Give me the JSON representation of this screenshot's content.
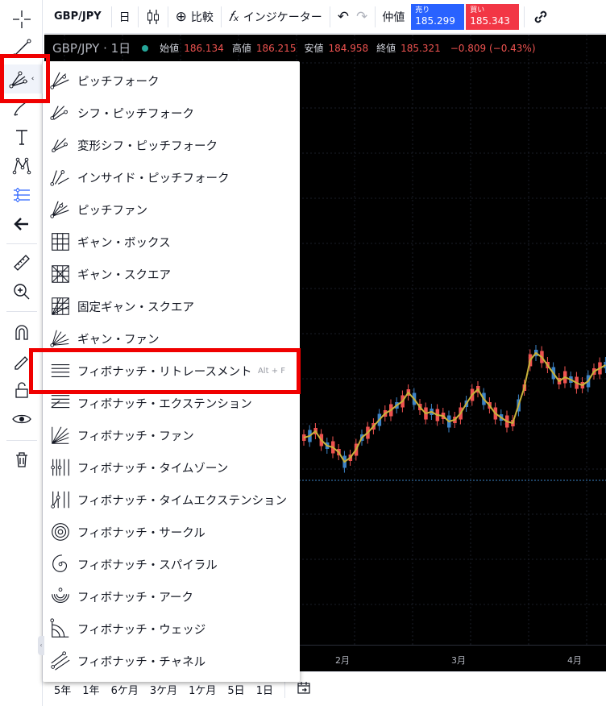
{
  "topbar": {
    "symbol": "GBP/JPY",
    "interval": "日",
    "compare_label": "比較",
    "indicators_label": "インジケーター",
    "mid_label": "仲値",
    "sell_label": "売り",
    "sell_price": "185.299",
    "buy_label": "買い",
    "buy_price": "185.343"
  },
  "legend": {
    "symbol": "GBP/JPY · 1日",
    "open_label": "始値",
    "open": "186.134",
    "high_label": "高値",
    "high": "186.215",
    "low_label": "安値",
    "low": "184.958",
    "close_label": "終値",
    "close": "185.321",
    "change": "−0.809 (−0.43%)"
  },
  "xaxis": {
    "labels": [
      "2月",
      "3月",
      "4月"
    ]
  },
  "bottombar": {
    "ranges": [
      "5年",
      "1年",
      "6ケ月",
      "3ケ月",
      "1ケ月",
      "5日",
      "1日"
    ]
  },
  "menu": {
    "items": [
      {
        "label": "ピッチフォーク",
        "icon": "pitchfork-icon"
      },
      {
        "label": "シフ・ピッチフォーク",
        "icon": "schiff-pitchfork-icon"
      },
      {
        "label": "変形シフ・ピッチフォーク",
        "icon": "modified-schiff-pitchfork-icon"
      },
      {
        "label": "インサイド・ピッチフォーク",
        "icon": "inside-pitchfork-icon"
      },
      {
        "label": "ピッチファン",
        "icon": "pitchfan-icon"
      },
      {
        "label": "ギャン・ボックス",
        "icon": "gann-box-icon"
      },
      {
        "label": "ギャン・スクエア",
        "icon": "gann-square-icon"
      },
      {
        "label": "固定ギャン・スクエア",
        "icon": "gann-square-fixed-icon"
      },
      {
        "label": "ギャン・ファン",
        "icon": "gann-fan-icon"
      },
      {
        "label": "フィボナッチ・リトレースメント",
        "icon": "fib-retracement-icon",
        "shortcut": "Alt + F"
      },
      {
        "label": "フィボナッチ・エクステンション",
        "icon": "fib-extension-icon"
      },
      {
        "label": "フィボナッチ・ファン",
        "icon": "fib-fan-icon"
      },
      {
        "label": "フィボナッチ・タイムゾーン",
        "icon": "fib-timezone-icon"
      },
      {
        "label": "フィボナッチ・タイムエクステンション",
        "icon": "fib-time-extension-icon"
      },
      {
        "label": "フィボナッチ・サークル",
        "icon": "fib-circle-icon"
      },
      {
        "label": "フィボナッチ・スパイラル",
        "icon": "fib-spiral-icon"
      },
      {
        "label": "フィボナッチ・アーク",
        "icon": "fib-arc-icon"
      },
      {
        "label": "フィボナッチ・ウェッジ",
        "icon": "fib-wedge-icon"
      },
      {
        "label": "フィボナッチ・チャネル",
        "icon": "fib-channel-icon"
      }
    ]
  },
  "colors": {
    "sell": "#2962ff",
    "buy": "#f23645",
    "highlight": "#f00000",
    "candle_up": "#ef5350",
    "candle_down": "#3d83c6",
    "ma": "#c8b23a"
  }
}
